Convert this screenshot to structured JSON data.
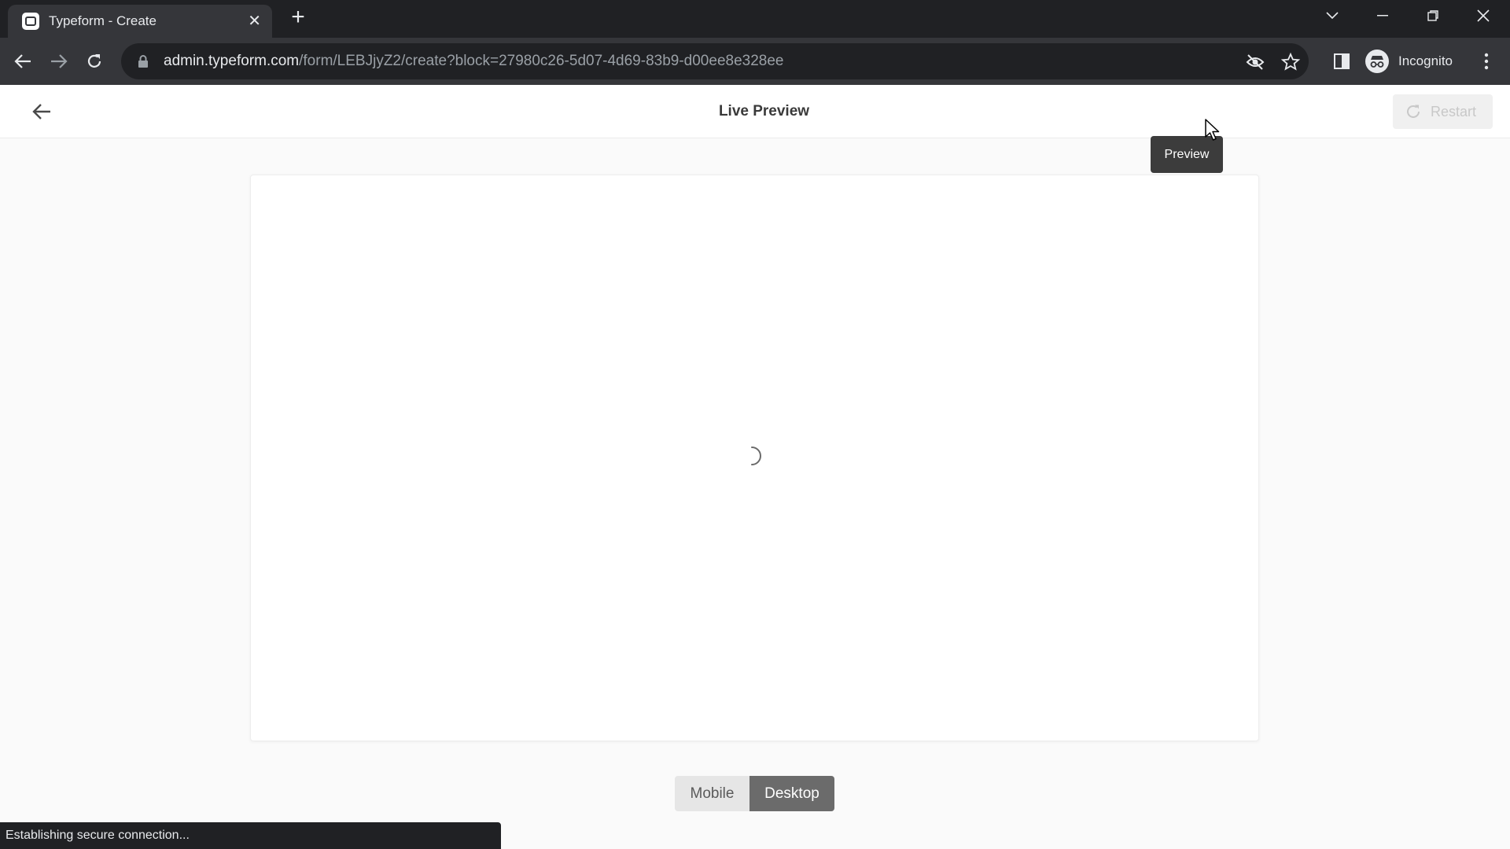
{
  "browser": {
    "tab_title": "Typeform - Create",
    "url_host": "admin.typeform.com",
    "url_path": "/form/LEBJjyZ2/create?block=27980c26-5d07-4d69-83b9-d00ee8e328ee",
    "profile_label": "Incognito",
    "status_text": "Establishing secure connection..."
  },
  "header": {
    "title": "Live Preview",
    "restart_label": "Restart"
  },
  "tooltip": {
    "text": "Preview"
  },
  "device_toggle": {
    "mobile_label": "Mobile",
    "desktop_label": "Desktop",
    "selected": "Desktop"
  },
  "colors": {
    "chrome_dark": "#202124",
    "chrome_toolbar": "#35363a",
    "toggle_selected": "#6b6b6b",
    "tooltip_bg": "#3c3c3c"
  }
}
